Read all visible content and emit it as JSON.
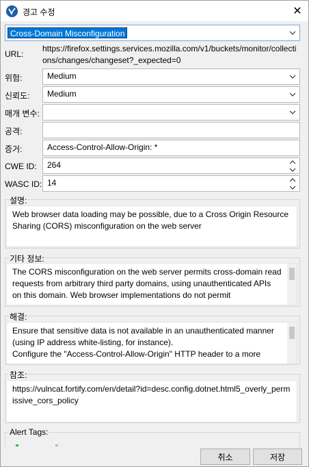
{
  "window": {
    "title": "경고 수정",
    "close_symbol": "✕"
  },
  "alert_title": {
    "value": "Cross-Domain Misconfiguration"
  },
  "fields": {
    "url_label": "URL:",
    "url_value": "https://firefox.settings.services.mozilla.com/v1/buckets/monitor/collections/changes/changeset?_expected=0",
    "risk_label": "위험:",
    "risk_value": "Medium",
    "confidence_label": "신뢰도:",
    "confidence_value": "Medium",
    "parameter_label": "매개 변수:",
    "parameter_value": "",
    "attack_label": "공격:",
    "attack_value": "",
    "evidence_label": "증거:",
    "evidence_value": "Access-Control-Allow-Origin: *",
    "cwe_label": "CWE ID:",
    "cwe_value": "264",
    "wasc_label": "WASC ID:",
    "wasc_value": "14"
  },
  "sections": {
    "description_label": "설명:",
    "description_text": "Web browser data loading may be possible, due to a Cross Origin Resource Sharing (CORS) misconfiguration on the web server",
    "other_info_label": "기타 정보:",
    "other_info_text": "The CORS misconfiguration on the web server permits cross-domain read requests from arbitrary third party domains, using unauthenticated APIs on this domain. Web browser implementations do not permit",
    "solution_label": "해결:",
    "solution_line1": "Ensure that sensitive data is not available in an unauthenticated manner (using IP address white-listing, for instance).",
    "solution_line2": "Configure the \"Access-Control-Allow-Origin\" HTTP header to a more",
    "reference_label": "참조:",
    "reference_text": "https://vulncat.fortify.com/en/detail?id=desc.config.dotnet.html5_overly_permissive_cors_policy",
    "alert_tags_label": "Alert Tags:"
  },
  "buttons": {
    "cancel": "취소",
    "save": "저장"
  },
  "icons": {
    "app": "zap-logo-icon",
    "dropdown": "chevron-down-icon",
    "spinner_up": "spin-up-icon",
    "spinner_down": "spin-down-icon"
  },
  "colors": {
    "selection": "#0078d7",
    "window_bg": "#f0f0f0"
  }
}
